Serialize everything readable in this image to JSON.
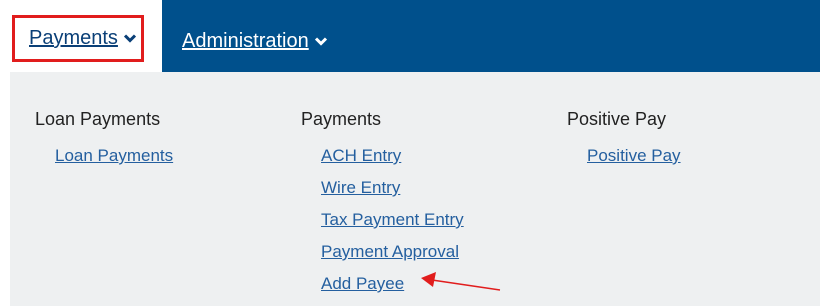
{
  "nav": {
    "payments_label": "Payments",
    "administration_label": "Administration"
  },
  "dropdown": {
    "columns": [
      {
        "heading": "Loan Payments",
        "links": [
          "Loan Payments"
        ]
      },
      {
        "heading": "Payments",
        "links": [
          "ACH Entry",
          "Wire Entry",
          "Tax Payment Entry",
          "Payment Approval",
          "Add Payee"
        ]
      },
      {
        "heading": "Positive Pay",
        "links": [
          "Positive Pay"
        ]
      }
    ]
  },
  "annotation": {
    "highlight_color": "#e11d1d",
    "arrow_target": "Add Payee"
  },
  "colors": {
    "nav_background": "#00508c",
    "link": "#245f9f",
    "dropdown_background": "#eef0f1"
  },
  "icons": [
    "chevron-down-icon",
    "chevron-down-icon"
  ]
}
